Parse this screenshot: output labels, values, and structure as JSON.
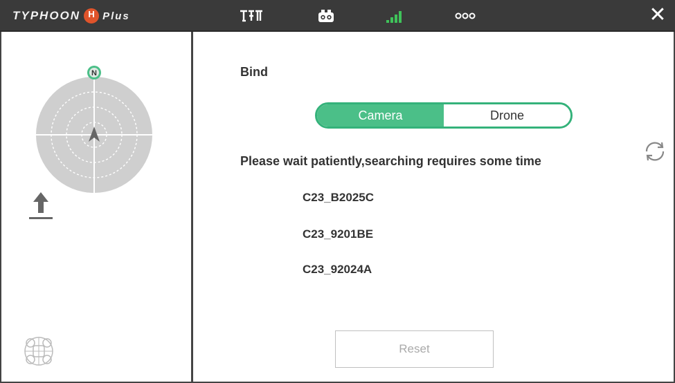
{
  "topbar": {
    "logo_prefix": "TYPHOON",
    "logo_suffix": "Plus",
    "icons": [
      "gimbal-mode-icon",
      "camera-icon",
      "signal-strength-icon",
      "more-icon",
      "close-icon"
    ],
    "close_label": "✕"
  },
  "sidebar": {
    "compass": {
      "north_label": "N"
    },
    "icons": [
      "compass-radar-icon",
      "takeoff-land-icon",
      "drone-status-icon"
    ]
  },
  "main": {
    "bind_title": "Bind",
    "segment": {
      "options": [
        "Camera",
        "Drone"
      ],
      "selected": "Camera"
    },
    "wait_message": "Please wait patiently,searching requires some time",
    "devices": [
      "C23_B2025C",
      "C23_9201BE",
      "C23_92024A"
    ],
    "reset_label": "Reset"
  },
  "colors": {
    "accent": "#4bbf88",
    "topbar": "#3a3a3a",
    "border": "#444444",
    "signal": "#3fc35a",
    "logo_h": "#e0542b"
  }
}
